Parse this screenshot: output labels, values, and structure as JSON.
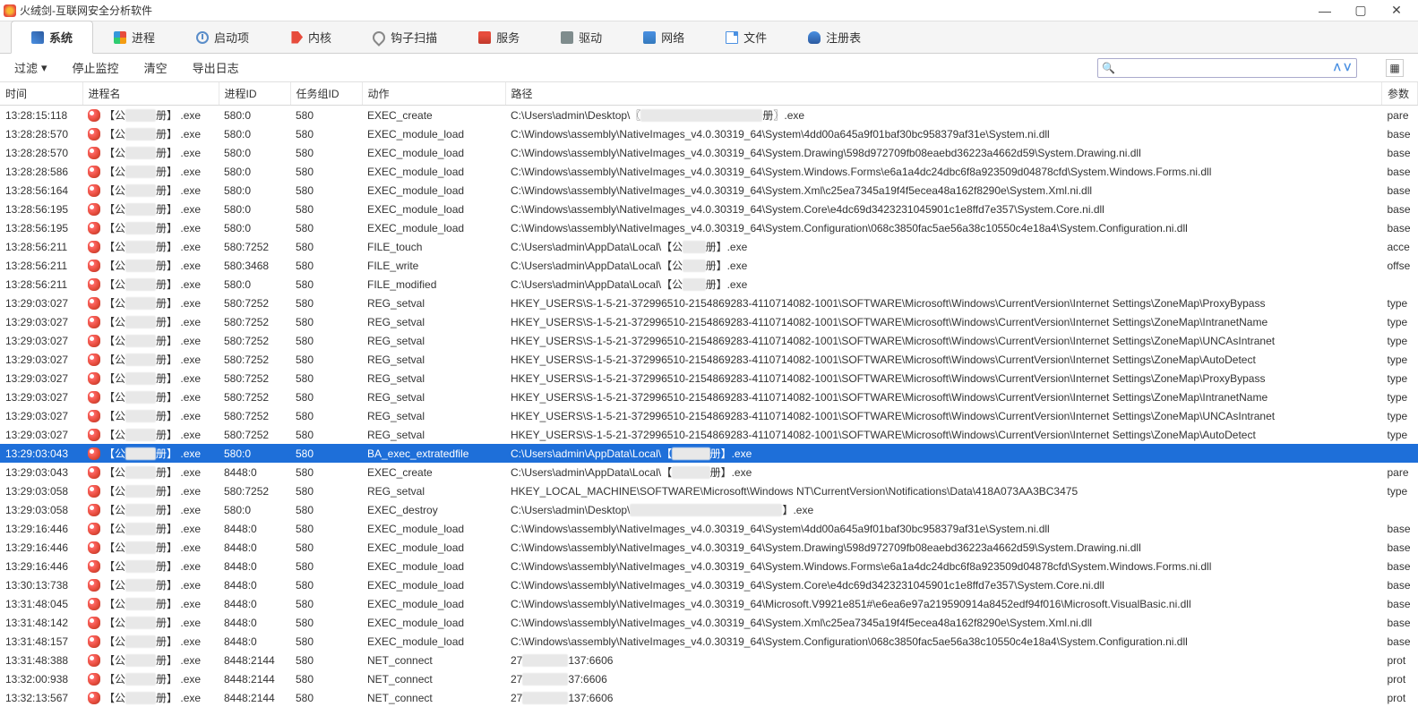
{
  "titlebar": {
    "title": "火绒剑-互联网安全分析软件"
  },
  "tabs": {
    "system": "系统",
    "process": "进程",
    "startup": "启动项",
    "kernel": "内核",
    "hook": "钩子扫描",
    "service": "服务",
    "driver": "驱动",
    "network": "网络",
    "file": "文件",
    "registry": "注册表"
  },
  "toolbar": {
    "filter": "过滤",
    "stop": "停止监控",
    "clear": "清空",
    "export": "导出日志"
  },
  "headers": {
    "time": "时间",
    "proc": "进程名",
    "pid": "进程ID",
    "task": "任务组ID",
    "action": "动作",
    "path": "路径",
    "param": "参数"
  },
  "mask_pre": "【公",
  "mask_mid": "册】",
  "mask_exe": ".exe",
  "rows": [
    {
      "t": "13:28:15:118",
      "pid": "580:0",
      "task": "580",
      "act": "EXEC_create",
      "path": "C:\\Users\\admin\\Desktop\\〖████████████████册〗.exe",
      "param": "pare"
    },
    {
      "t": "13:28:28:570",
      "pid": "580:0",
      "task": "580",
      "act": "EXEC_module_load",
      "path": "C:\\Windows\\assembly\\NativeImages_v4.0.30319_64\\System\\4dd00a645a9f01baf30bc958379af31e\\System.ni.dll",
      "param": "base"
    },
    {
      "t": "13:28:28:570",
      "pid": "580:0",
      "task": "580",
      "act": "EXEC_module_load",
      "path": "C:\\Windows\\assembly\\NativeImages_v4.0.30319_64\\System.Drawing\\598d972709fb08eaebd36223a4662d59\\System.Drawing.ni.dll",
      "param": "base"
    },
    {
      "t": "13:28:28:586",
      "pid": "580:0",
      "task": "580",
      "act": "EXEC_module_load",
      "path": "C:\\Windows\\assembly\\NativeImages_v4.0.30319_64\\System.Windows.Forms\\e6a1a4dc24dbc6f8a923509d04878cfd\\System.Windows.Forms.ni.dll",
      "param": "base"
    },
    {
      "t": "13:28:56:164",
      "pid": "580:0",
      "task": "580",
      "act": "EXEC_module_load",
      "path": "C:\\Windows\\assembly\\NativeImages_v4.0.30319_64\\System.Xml\\c25ea7345a19f4f5ecea48a162f8290e\\System.Xml.ni.dll",
      "param": "base"
    },
    {
      "t": "13:28:56:195",
      "pid": "580:0",
      "task": "580",
      "act": "EXEC_module_load",
      "path": "C:\\Windows\\assembly\\NativeImages_v4.0.30319_64\\System.Core\\e4dc69d3423231045901c1e8ffd7e357\\System.Core.ni.dll",
      "param": "base"
    },
    {
      "t": "13:28:56:195",
      "pid": "580:0",
      "task": "580",
      "act": "EXEC_module_load",
      "path": "C:\\Windows\\assembly\\NativeImages_v4.0.30319_64\\System.Configuration\\068c3850fac5ae56a38c10550c4e18a4\\System.Configuration.ni.dll",
      "param": "base"
    },
    {
      "t": "13:28:56:211",
      "pid": "580:7252",
      "task": "580",
      "act": "FILE_touch",
      "path": "C:\\Users\\admin\\AppData\\Local\\【公███册】.exe",
      "param": "acce"
    },
    {
      "t": "13:28:56:211",
      "pid": "580:3468",
      "task": "580",
      "act": "FILE_write",
      "path": "C:\\Users\\admin\\AppData\\Local\\【公███册】.exe",
      "param": "offse"
    },
    {
      "t": "13:28:56:211",
      "pid": "580:0",
      "task": "580",
      "act": "FILE_modified",
      "path": "C:\\Users\\admin\\AppData\\Local\\【公███册】.exe",
      "param": ""
    },
    {
      "t": "13:29:03:027",
      "pid": "580:7252",
      "task": "580",
      "act": "REG_setval",
      "path": "HKEY_USERS\\S-1-5-21-372996510-2154869283-4110714082-1001\\SOFTWARE\\Microsoft\\Windows\\CurrentVersion\\Internet Settings\\ZoneMap\\ProxyBypass",
      "param": "type"
    },
    {
      "t": "13:29:03:027",
      "pid": "580:7252",
      "task": "580",
      "act": "REG_setval",
      "path": "HKEY_USERS\\S-1-5-21-372996510-2154869283-4110714082-1001\\SOFTWARE\\Microsoft\\Windows\\CurrentVersion\\Internet Settings\\ZoneMap\\IntranetName",
      "param": "type"
    },
    {
      "t": "13:29:03:027",
      "pid": "580:7252",
      "task": "580",
      "act": "REG_setval",
      "path": "HKEY_USERS\\S-1-5-21-372996510-2154869283-4110714082-1001\\SOFTWARE\\Microsoft\\Windows\\CurrentVersion\\Internet Settings\\ZoneMap\\UNCAsIntranet",
      "param": "type"
    },
    {
      "t": "13:29:03:027",
      "pid": "580:7252",
      "task": "580",
      "act": "REG_setval",
      "path": "HKEY_USERS\\S-1-5-21-372996510-2154869283-4110714082-1001\\SOFTWARE\\Microsoft\\Windows\\CurrentVersion\\Internet Settings\\ZoneMap\\AutoDetect",
      "param": "type"
    },
    {
      "t": "13:29:03:027",
      "pid": "580:7252",
      "task": "580",
      "act": "REG_setval",
      "path": "HKEY_USERS\\S-1-5-21-372996510-2154869283-4110714082-1001\\SOFTWARE\\Microsoft\\Windows\\CurrentVersion\\Internet Settings\\ZoneMap\\ProxyBypass",
      "param": "type"
    },
    {
      "t": "13:29:03:027",
      "pid": "580:7252",
      "task": "580",
      "act": "REG_setval",
      "path": "HKEY_USERS\\S-1-5-21-372996510-2154869283-4110714082-1001\\SOFTWARE\\Microsoft\\Windows\\CurrentVersion\\Internet Settings\\ZoneMap\\IntranetName",
      "param": "type"
    },
    {
      "t": "13:29:03:027",
      "pid": "580:7252",
      "task": "580",
      "act": "REG_setval",
      "path": "HKEY_USERS\\S-1-5-21-372996510-2154869283-4110714082-1001\\SOFTWARE\\Microsoft\\Windows\\CurrentVersion\\Internet Settings\\ZoneMap\\UNCAsIntranet",
      "param": "type"
    },
    {
      "t": "13:29:03:027",
      "pid": "580:7252",
      "task": "580",
      "act": "REG_setval",
      "path": "HKEY_USERS\\S-1-5-21-372996510-2154869283-4110714082-1001\\SOFTWARE\\Microsoft\\Windows\\CurrentVersion\\Internet Settings\\ZoneMap\\AutoDetect",
      "param": "type"
    },
    {
      "t": "13:29:03:043",
      "pid": "580:0",
      "task": "580",
      "act": "BA_exec_extratedfile",
      "path": "C:\\Users\\admin\\AppData\\Local\\【█████册】.exe",
      "param": "",
      "sel": true
    },
    {
      "t": "13:29:03:043",
      "pid": "8448:0",
      "task": "580",
      "act": "EXEC_create",
      "path": "C:\\Users\\admin\\AppData\\Local\\【█████册】.exe",
      "param": "pare"
    },
    {
      "t": "13:29:03:058",
      "pid": "580:7252",
      "task": "580",
      "act": "REG_setval",
      "path": "HKEY_LOCAL_MACHINE\\SOFTWARE\\Microsoft\\Windows NT\\CurrentVersion\\Notifications\\Data\\418A073AA3BC3475",
      "param": "type"
    },
    {
      "t": "13:29:03:058",
      "pid": "580:0",
      "task": "580",
      "act": "EXEC_destroy",
      "path": "C:\\Users\\admin\\Desktop\\████████████████████】.exe",
      "param": ""
    },
    {
      "t": "13:29:16:446",
      "pid": "8448:0",
      "task": "580",
      "act": "EXEC_module_load",
      "path": "C:\\Windows\\assembly\\NativeImages_v4.0.30319_64\\System\\4dd00a645a9f01baf30bc958379af31e\\System.ni.dll",
      "param": "base"
    },
    {
      "t": "13:29:16:446",
      "pid": "8448:0",
      "task": "580",
      "act": "EXEC_module_load",
      "path": "C:\\Windows\\assembly\\NativeImages_v4.0.30319_64\\System.Drawing\\598d972709fb08eaebd36223a4662d59\\System.Drawing.ni.dll",
      "param": "base"
    },
    {
      "t": "13:29:16:446",
      "pid": "8448:0",
      "task": "580",
      "act": "EXEC_module_load",
      "path": "C:\\Windows\\assembly\\NativeImages_v4.0.30319_64\\System.Windows.Forms\\e6a1a4dc24dbc6f8a923509d04878cfd\\System.Windows.Forms.ni.dll",
      "param": "base"
    },
    {
      "t": "13:30:13:738",
      "pid": "8448:0",
      "task": "580",
      "act": "EXEC_module_load",
      "path": "C:\\Windows\\assembly\\NativeImages_v4.0.30319_64\\System.Core\\e4dc69d3423231045901c1e8ffd7e357\\System.Core.ni.dll",
      "param": "base"
    },
    {
      "t": "13:31:48:045",
      "pid": "8448:0",
      "task": "580",
      "act": "EXEC_module_load",
      "path": "C:\\Windows\\assembly\\NativeImages_v4.0.30319_64\\Microsoft.V9921e851#\\e6ea6e97a219590914a8452edf94f016\\Microsoft.VisualBasic.ni.dll",
      "param": "base"
    },
    {
      "t": "13:31:48:142",
      "pid": "8448:0",
      "task": "580",
      "act": "EXEC_module_load",
      "path": "C:\\Windows\\assembly\\NativeImages_v4.0.30319_64\\System.Xml\\c25ea7345a19f4f5ecea48a162f8290e\\System.Xml.ni.dll",
      "param": "base"
    },
    {
      "t": "13:31:48:157",
      "pid": "8448:0",
      "task": "580",
      "act": "EXEC_module_load",
      "path": "C:\\Windows\\assembly\\NativeImages_v4.0.30319_64\\System.Configuration\\068c3850fac5ae56a38c10550c4e18a4\\System.Configuration.ni.dll",
      "param": "base"
    },
    {
      "t": "13:31:48:388",
      "pid": "8448:2144",
      "task": "580",
      "act": "NET_connect",
      "path": "27██████137:6606",
      "param": "prot"
    },
    {
      "t": "13:32:00:938",
      "pid": "8448:2144",
      "task": "580",
      "act": "NET_connect",
      "path": "27██████37:6606",
      "param": "prot"
    },
    {
      "t": "13:32:13:567",
      "pid": "8448:2144",
      "task": "580",
      "act": "NET_connect",
      "path": "27██████137:6606",
      "param": "prot"
    }
  ]
}
